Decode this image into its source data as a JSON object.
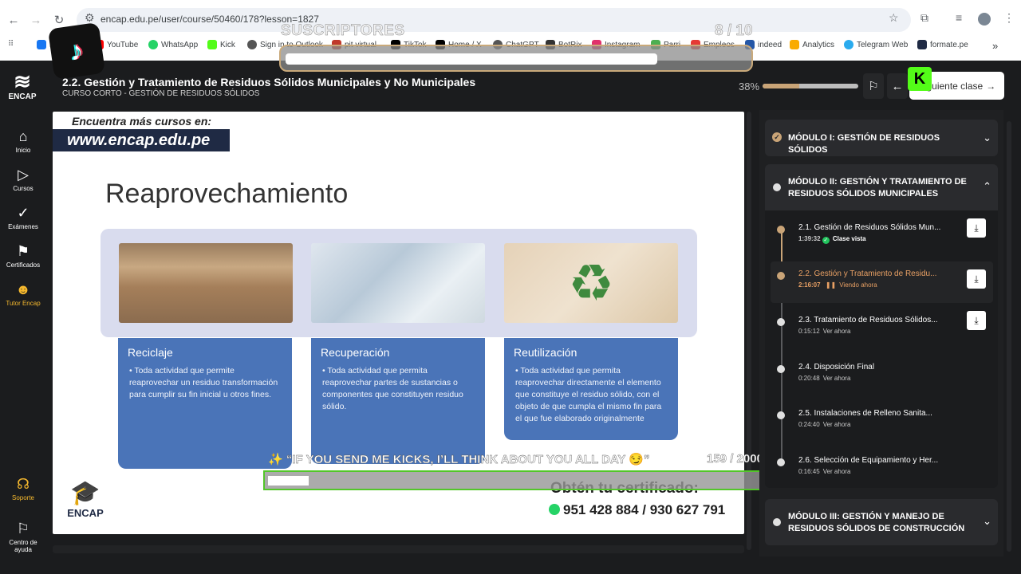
{
  "browser": {
    "url": "encap.edu.pe/user/course/50460/178?lesson=1827",
    "bookmarks": [
      {
        "label": "F",
        "color": "#1877f2"
      },
      {
        "label": "YouTube",
        "color": "#ff0000"
      },
      {
        "label": "WhatsApp",
        "color": "#25d366"
      },
      {
        "label": "Kick",
        "color": "#53fc18"
      },
      {
        "label": "Sign in to Outlook",
        "color": "#555555"
      },
      {
        "label": "pit virtual",
        "color": "#c0392b"
      },
      {
        "label": "TikTok",
        "color": "#000000"
      },
      {
        "label": "Home / X",
        "color": "#000000"
      },
      {
        "label": "ChatGPT",
        "color": "#555555"
      },
      {
        "label": "BotRix",
        "color": "#333333"
      },
      {
        "label": "Instagram",
        "color": "#e1306c"
      },
      {
        "label": "Parri",
        "color": "#4caf50"
      },
      {
        "label": "Empleos",
        "color": "#e53935"
      },
      {
        "label": "indeed",
        "color": "#2557a7"
      },
      {
        "label": "Analytics",
        "color": "#f9ab00"
      },
      {
        "label": "Telegram Web",
        "color": "#2aabee"
      },
      {
        "label": "formate.pe",
        "color": "#1f2a44"
      }
    ]
  },
  "overlay": {
    "subscribers_label": "SUSCRIPTORES",
    "subscribers_count": "8 / 10",
    "subscribers_progress": 0.8,
    "kicks_text": "✨ “IF YOU SEND ME KICKS, I’LL THINK ABOUT YOU ALL DAY 😏”",
    "kicks_count": "159 / 2000",
    "kicks_progress": 0.08
  },
  "header": {
    "logo": "ENCAP",
    "title": "2.2. Gestión y Tratamiento de Residuos Sólidos Municipales y No Municipales",
    "subtitle": "CURSO CORTO - GESTIÓN DE RESIDUOS SÓLIDOS",
    "progress_label": "38%",
    "progress": 0.38,
    "next_label": "Siguiente clase",
    "kick_badge": "K"
  },
  "rail": [
    {
      "label": "Inicio",
      "icon": "home-icon",
      "glyph": "⌂"
    },
    {
      "label": "Cursos",
      "icon": "play-circle-icon",
      "glyph": "▷"
    },
    {
      "label": "Exámenes",
      "icon": "check-icon",
      "glyph": "✓"
    },
    {
      "label": "Certificados",
      "icon": "bookmark-icon",
      "glyph": "🔖"
    },
    {
      "label": "Tutor Encap",
      "icon": "robot-icon",
      "glyph": "🤖"
    },
    {
      "label": "Soporte",
      "icon": "headset-icon",
      "glyph": "🎧"
    },
    {
      "label": "Centro de ayuda",
      "icon": "flag-icon",
      "glyph": "⚑"
    }
  ],
  "slide": {
    "promo_small": "Encuentra más cursos en:",
    "promo_url": "www.encap.edu.pe",
    "title": "Reaprovechamiento",
    "cards": [
      {
        "heading": "Reciclaje",
        "body": "• Toda actividad que permite reaprovechar un residuo transformación para cumplir su fin inicial u otros fines."
      },
      {
        "heading": "Recuperación",
        "body": "• Toda actividad que permita reaprovechar partes de sustancias o componentes que constituyen residuo sólido."
      },
      {
        "heading": "Reutilización",
        "body": "• Toda actividad que permita reaprovechar directamente el elemento que constituye el residuo sólido, con el objeto de que cumpla el mismo fin para el que fue elaborado originalmente"
      }
    ],
    "footer_logo": "ENCAP",
    "cert_title": "Obtén tu certificado:",
    "cert_phone": "951 428 884 / 930 627 791"
  },
  "sidebar": {
    "module1": "MÓDULO I: GESTIÓN DE RESIDUOS SÓLIDOS",
    "module2": "MÓDULO II: GESTIÓN Y TRATAMIENTO DE RESIDUOS SÓLIDOS MUNICIPALES",
    "module3": "MÓDULO III: GESTIÓN Y MANEJO DE RESIDUOS SÓLIDOS DE CONSTRUCCIÓN",
    "lessons": [
      {
        "title": "2.1. Gestión de Residuos Sólidos Mun...",
        "time": "1:39:32",
        "status": "Clase vista"
      },
      {
        "title": "2.2. Gestión y Tratamiento de Residu...",
        "time": "2:16:07",
        "status": "Viendo ahora"
      },
      {
        "title": "2.3. Tratamiento de Residuos Sólidos...",
        "time": "0:15:12",
        "status": "Ver ahora"
      },
      {
        "title": "2.4. Disposición Final",
        "time": "0:20:48",
        "status": "Ver ahora"
      },
      {
        "title": "2.5. Instalaciones de Relleno Sanita...",
        "time": "0:24:40",
        "status": "Ver ahora"
      },
      {
        "title": "2.6. Selección de Equipamiento y Her...",
        "time": "0:16:45",
        "status": "Ver ahora"
      }
    ]
  }
}
